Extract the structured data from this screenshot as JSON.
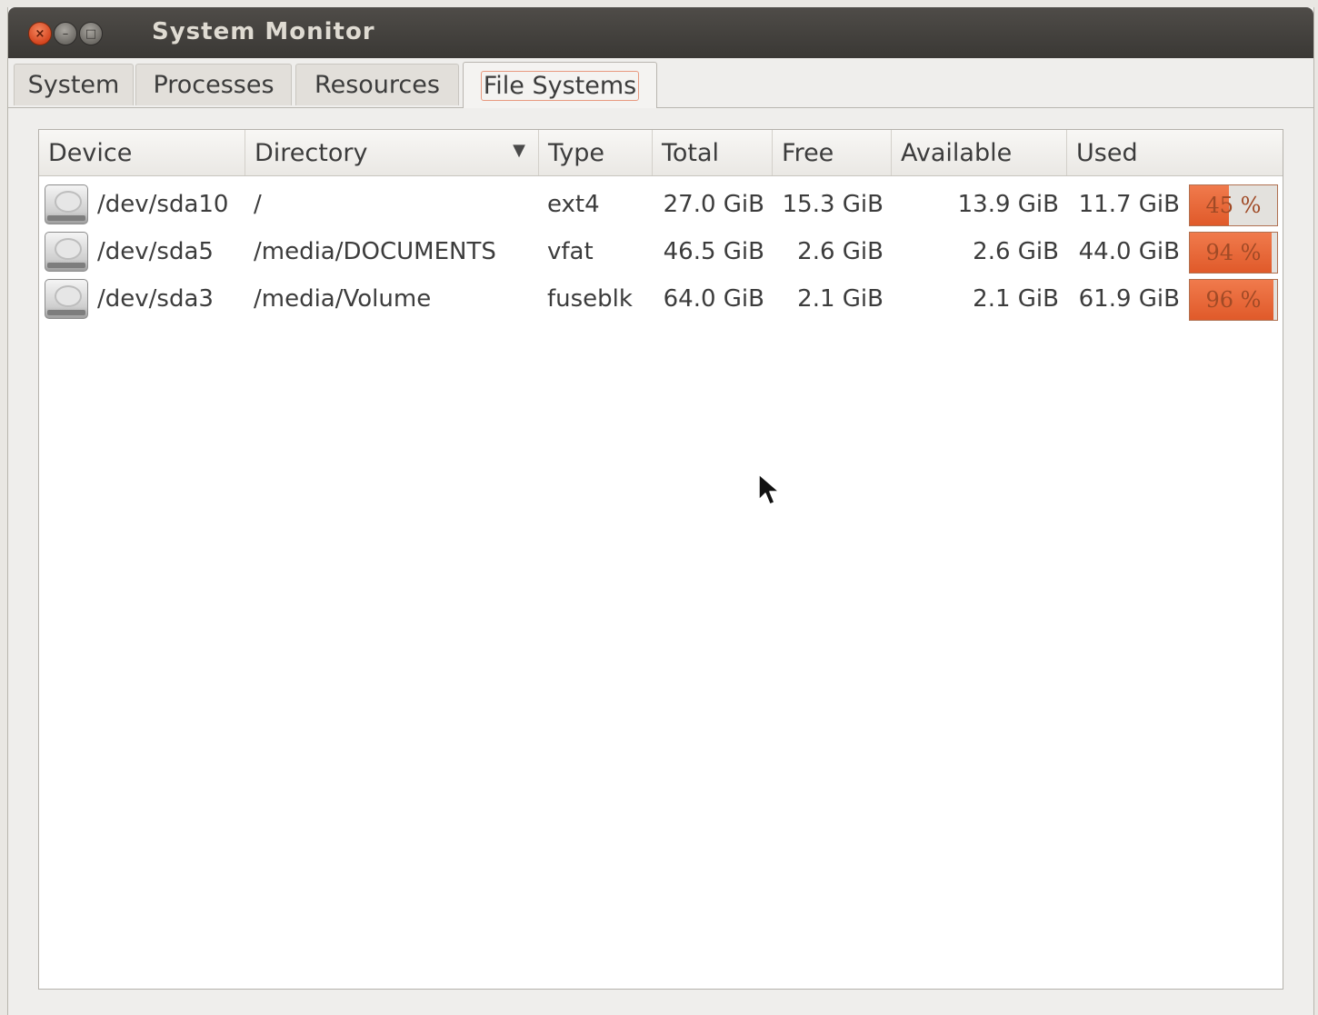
{
  "window": {
    "title": "System Monitor",
    "controls": {
      "close_icon": "×",
      "minimize_icon": "–",
      "maximize_icon": "□"
    }
  },
  "tabs": [
    {
      "label": "System"
    },
    {
      "label": "Processes"
    },
    {
      "label": "Resources"
    },
    {
      "label": "File Systems",
      "active": true
    }
  ],
  "table": {
    "columns": [
      "Device",
      "Directory",
      "Type",
      "Total",
      "Free",
      "Available",
      "Used"
    ],
    "sort_column": "Directory",
    "sort_indicator": "▼",
    "rows": [
      {
        "device": "/dev/sda10",
        "directory": "/",
        "type": "ext4",
        "total": "27.0 GiB",
        "free": "15.3 GiB",
        "available": "13.9 GiB",
        "used": "11.7 GiB",
        "percent_label": "45 %",
        "percent": 45
      },
      {
        "device": "/dev/sda5",
        "directory": "/media/DOCUMENTS",
        "type": "vfat",
        "total": "46.5 GiB",
        "free": "2.6 GiB",
        "available": "2.6 GiB",
        "used": "44.0 GiB",
        "percent_label": "94 %",
        "percent": 94
      },
      {
        "device": "/dev/sda3",
        "directory": "/media/Volume",
        "type": "fuseblk",
        "total": "64.0 GiB",
        "free": "2.1 GiB",
        "available": "2.1 GiB",
        "used": "61.9 GiB",
        "percent_label": "96 %",
        "percent": 96
      }
    ]
  },
  "colors": {
    "usage_bar": "#e8643a",
    "titlebar": "#3f3d39",
    "close_button": "#e0542a"
  },
  "icons": {
    "device": "harddisk-icon",
    "cursor": "mouse-pointer-icon"
  }
}
